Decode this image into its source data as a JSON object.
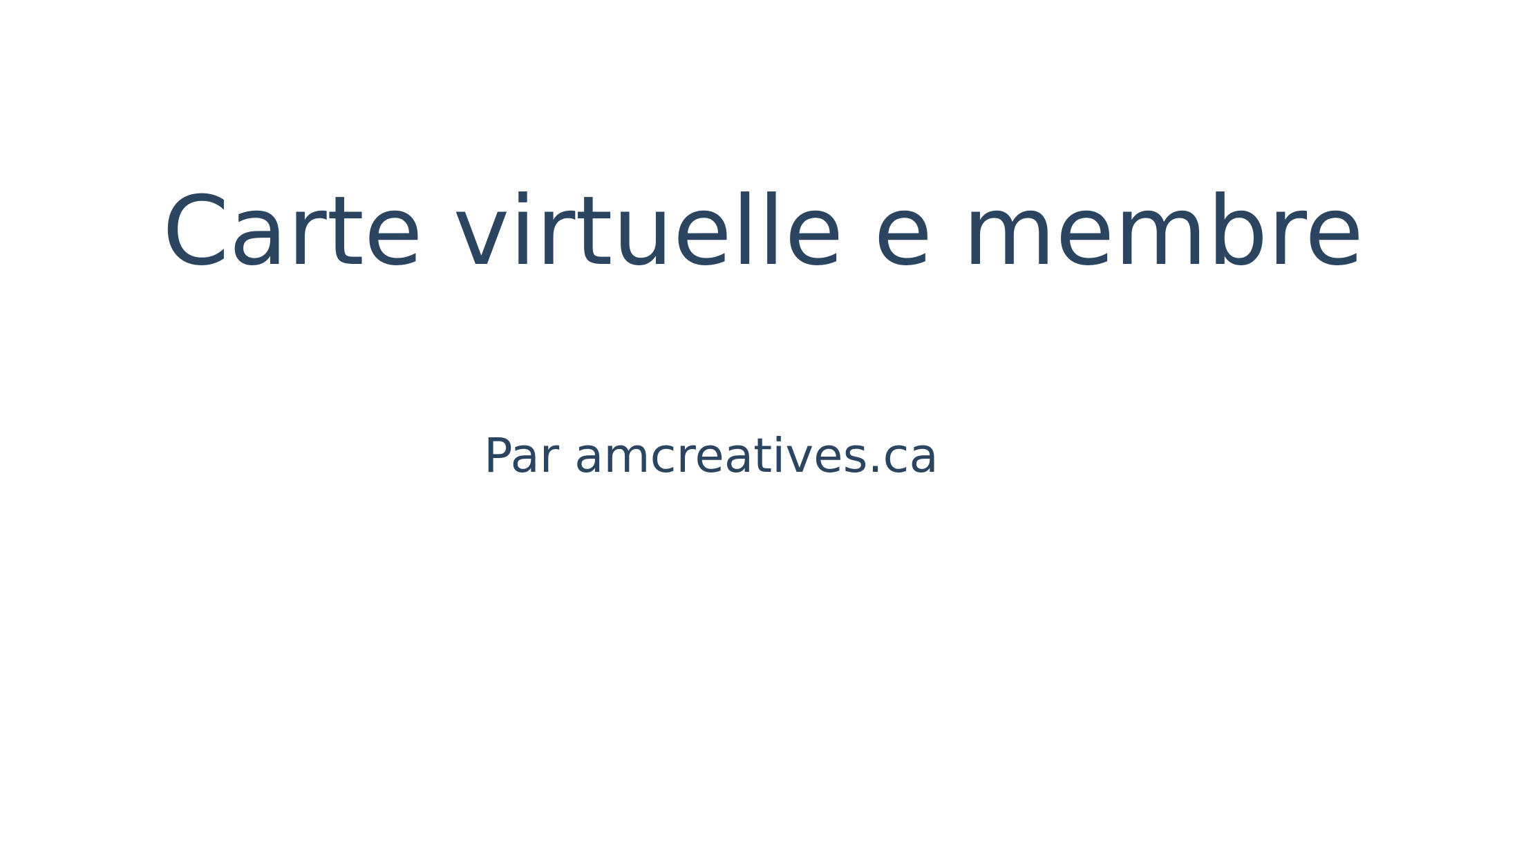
{
  "slide": {
    "title": "Carte virtuelle e membre",
    "subtitle": "Par amcreatives.ca"
  },
  "colors": {
    "text": "#2b4560",
    "background": "#ffffff"
  }
}
